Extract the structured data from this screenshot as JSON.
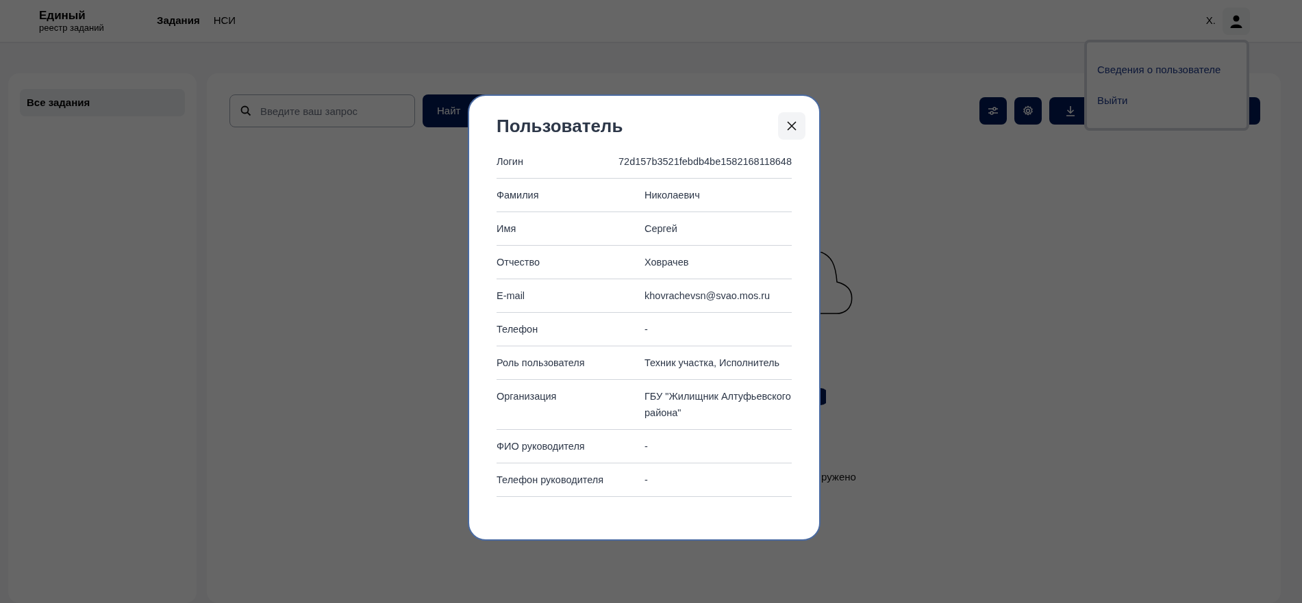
{
  "header": {
    "logo_title": "Единый",
    "logo_subtitle": "реестр заданий",
    "nav": [
      {
        "label": "Задания",
        "selected": true
      },
      {
        "label": "НСИ",
        "selected": false
      }
    ],
    "user_initial": "Х."
  },
  "user_menu": {
    "items": [
      "Сведения о пользователе",
      "Выйти"
    ]
  },
  "sidebar": {
    "items": [
      {
        "label": "Все задания",
        "selected": true
      }
    ]
  },
  "toolbar": {
    "search": {
      "placeholder": "Введите ваш запрос"
    },
    "find_button": "Найт"
  },
  "empty_state": {
    "message": "ружено"
  },
  "modal": {
    "title": "Пользователь",
    "fields": [
      {
        "label": "Логин",
        "value": "72d157b3521febdb4be1582168118648"
      },
      {
        "label": "Фамилия",
        "value": "Николаевич"
      },
      {
        "label": "Имя",
        "value": "Сергей"
      },
      {
        "label": "Отчество",
        "value": "Ховрачев"
      },
      {
        "label": "E-mail",
        "value": "khovrachevsn@svao.mos.ru"
      },
      {
        "label": "Телефон",
        "value": "-"
      },
      {
        "label": "Роль пользователя",
        "value": "Техник участка, Исполнитель"
      },
      {
        "label": "Организация",
        "value": "ГБУ \"Жилищник Алтуфьевского района\""
      },
      {
        "label": "ФИО руководителя",
        "value": "-"
      },
      {
        "label": "Телефон руководителя",
        "value": "-"
      }
    ]
  }
}
